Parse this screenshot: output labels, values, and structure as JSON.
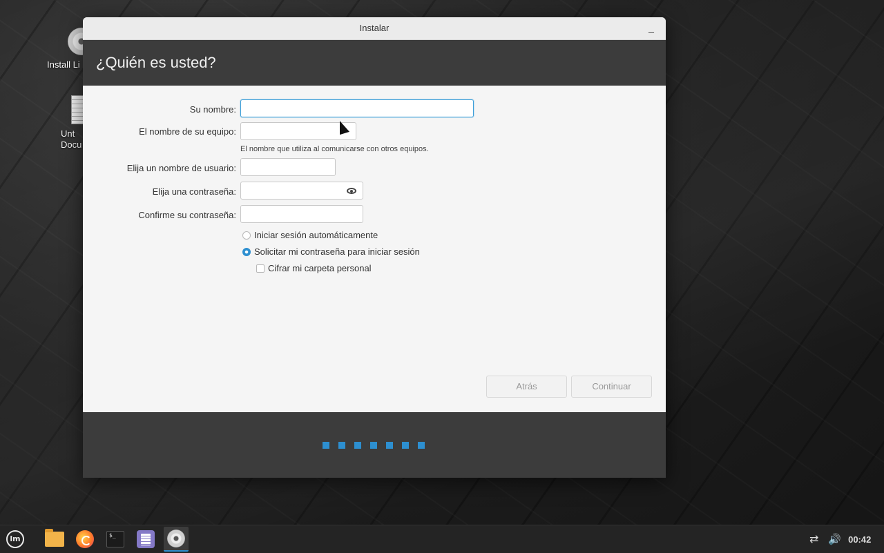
{
  "desktop": {
    "icons": [
      {
        "label": "Install Li",
        "icon": "disc-icon"
      },
      {
        "label": "Unt\nDocu",
        "icon": "document-icon"
      }
    ]
  },
  "window": {
    "title": "Instalar",
    "minimize_glyph": "_",
    "heading": "¿Quién es usted?"
  },
  "form": {
    "name_label": "Su nombre:",
    "computer_label": "El nombre de su equipo:",
    "computer_hint": "El nombre que utiliza al comunicarse con otros equipos.",
    "username_label": "Elija un nombre de usuario:",
    "password_label": "Elija una contraseña:",
    "confirm_label": "Confirme su contraseña:",
    "name_value": "",
    "computer_value": "",
    "username_value": "",
    "password_value": "",
    "confirm_value": ""
  },
  "options": {
    "auto_login": "Iniciar sesión automáticamente",
    "require_password": "Solicitar mi contraseña para iniciar sesión",
    "encrypt_home": "Cifrar mi carpeta personal",
    "selected": "require_password"
  },
  "buttons": {
    "back": "Atrás",
    "continue": "Continuar"
  },
  "progress": {
    "steps": 7
  },
  "taskbar": {
    "menu_glyph": "lm",
    "terminal_glyph": "$_",
    "clock": "00:42",
    "accent": "#2d8fd0"
  }
}
